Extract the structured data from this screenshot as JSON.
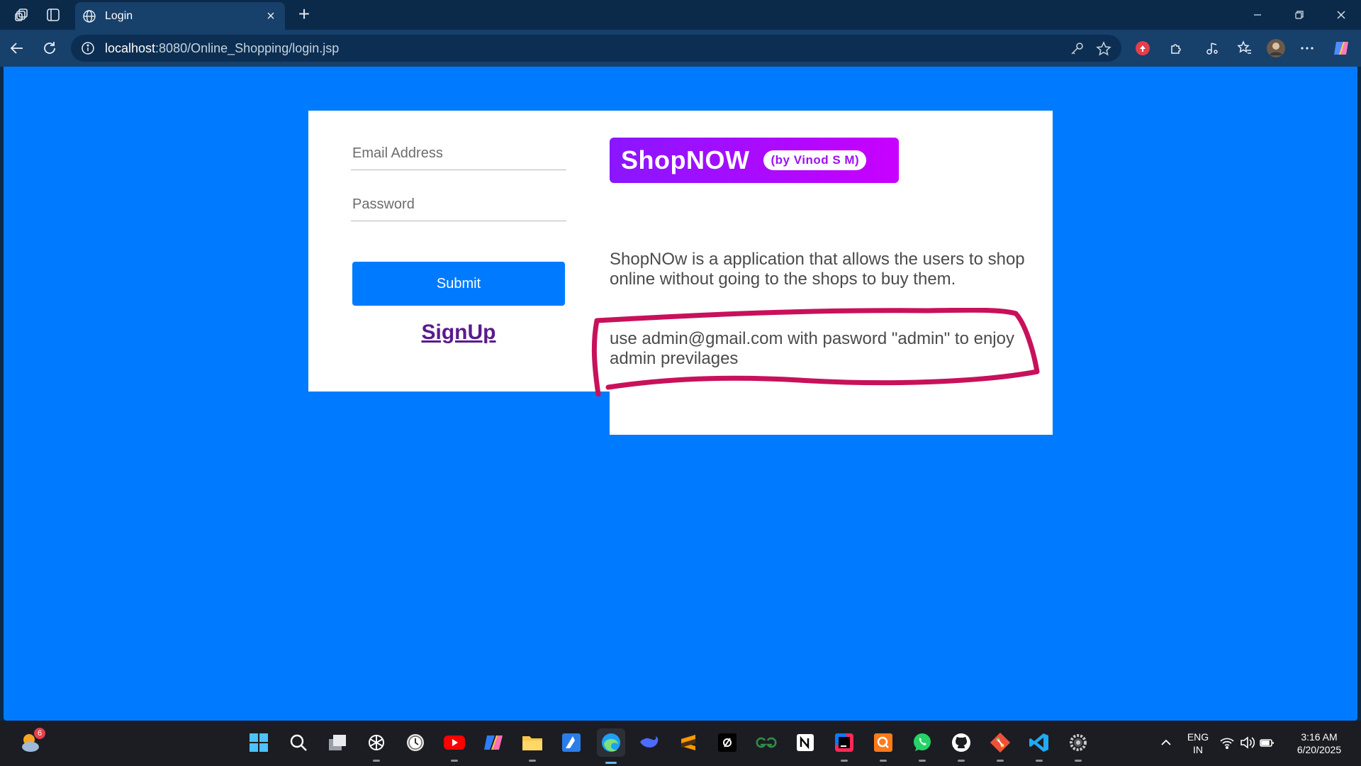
{
  "browser": {
    "tab_title": "Login",
    "url_host": "localhost",
    "url_path": ":8080/Online_Shopping/login.jsp"
  },
  "login": {
    "email_placeholder": "Email Address",
    "password_placeholder": "Password",
    "submit_label": "Submit",
    "signup_label": "SignUp"
  },
  "info": {
    "brand_name": "ShopNOW",
    "brand_author": "(by Vinod S M)",
    "description": "ShopNOw is a application that allows the users to shop online without going to the shops to buy them.",
    "admin_hint": "use admin@gmail.com with pasword \"admin\" to enjoy admin previlages"
  },
  "colors": {
    "page_background": "#007bff",
    "brand_gradient_start": "#8a16ff",
    "brand_gradient_end": "#c800ff",
    "annotation_stroke": "#c8115a",
    "signup_link": "#5a1b8c"
  },
  "taskbar": {
    "weather_badge": "6",
    "language": "ENG",
    "region": "IN",
    "time": "3:16 AM",
    "date": "6/20/2025",
    "apps": [
      "windows-start-icon",
      "search-icon",
      "task-view-icon",
      "chatgpt-icon",
      "clock-icon",
      "youtube-icon",
      "copilot-icon",
      "file-explorer-icon",
      "autocad-icon",
      "edge-icon",
      "deepseek-icon",
      "sublime-text-icon",
      "terminal-icon",
      "geeksforgeeks-icon",
      "notion-icon",
      "intellij-icon",
      "q-app-icon",
      "whatsapp-icon",
      "github-icon",
      "git-icon",
      "vscode-icon",
      "settings-icon"
    ]
  }
}
